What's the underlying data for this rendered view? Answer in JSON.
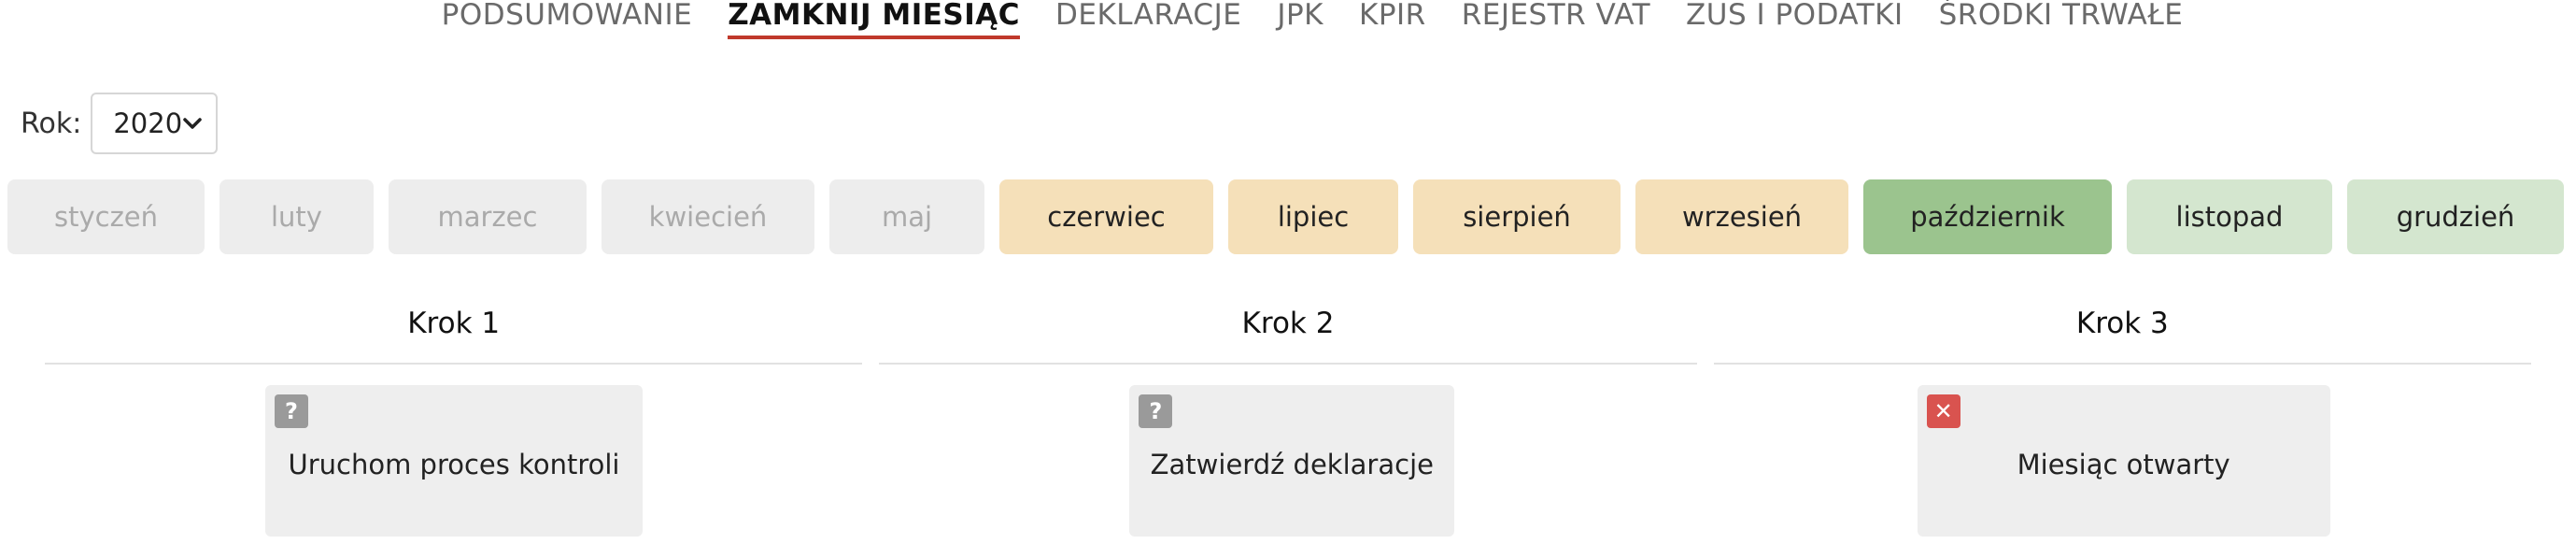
{
  "nav": {
    "items": [
      {
        "label": "PODSUMOWANIE",
        "active": false
      },
      {
        "label": "ZAMKNIJ MIESIĄC",
        "active": true
      },
      {
        "label": "DEKLARACJE",
        "active": false
      },
      {
        "label": "JPK",
        "active": false
      },
      {
        "label": "KPIR",
        "active": false
      },
      {
        "label": "REJESTR VAT",
        "active": false
      },
      {
        "label": "ZUS I PODATKI",
        "active": false
      },
      {
        "label": "ŚRODKI TRWAŁE",
        "active": false
      }
    ],
    "active_color": "#c0392b"
  },
  "year": {
    "label": "Rok:",
    "selected": "2020"
  },
  "months": [
    {
      "label": "styczeń",
      "state": "disabled"
    },
    {
      "label": "luty",
      "state": "disabled"
    },
    {
      "label": "marzec",
      "state": "disabled"
    },
    {
      "label": "kwiecień",
      "state": "disabled"
    },
    {
      "label": "maj",
      "state": "disabled"
    },
    {
      "label": "czerwiec",
      "state": "pending"
    },
    {
      "label": "lipiec",
      "state": "pending"
    },
    {
      "label": "sierpień",
      "state": "pending"
    },
    {
      "label": "wrzesień",
      "state": "pending"
    },
    {
      "label": "październik",
      "state": "current"
    },
    {
      "label": "listopad",
      "state": "future"
    },
    {
      "label": "grudzień",
      "state": "future"
    }
  ],
  "month_colors": {
    "disabled": "#ededed",
    "pending": "#f5e0b9",
    "current": "#9bc48e",
    "future": "#d4e6cf"
  },
  "steps": [
    {
      "title": "Krok 1",
      "card_label": "Uruchom proces kontroli",
      "status_icon": "question-icon",
      "status_glyph": "?"
    },
    {
      "title": "Krok 2",
      "card_label": "Zatwierdź deklaracje",
      "status_icon": "question-icon",
      "status_glyph": "?"
    },
    {
      "title": "Krok 3",
      "card_label": "Miesiąc otwarty",
      "status_icon": "close-icon",
      "status_glyph": "✕"
    }
  ],
  "status_colors": {
    "question": "#9a9a9a",
    "error": "#d9534f"
  }
}
